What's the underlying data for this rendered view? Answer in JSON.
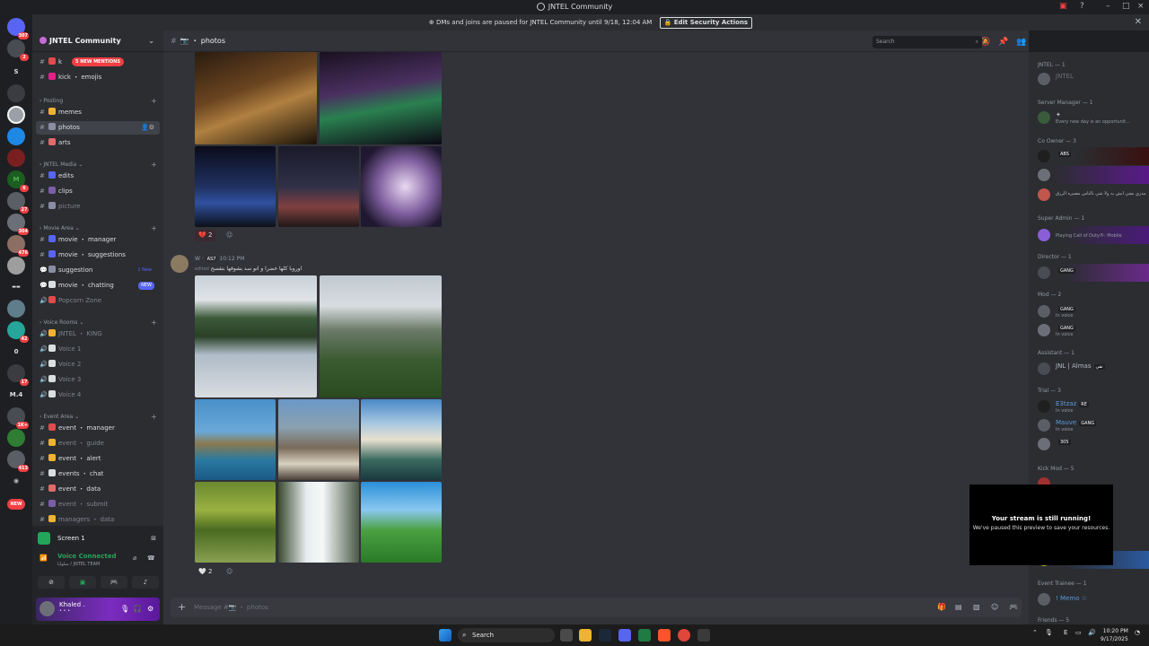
{
  "window": {
    "title": "JNTEL Community",
    "controls": [
      "–",
      "□",
      "×"
    ]
  },
  "banner": {
    "text": "DMs and joins are paused for JNTEL Community until 9/18, 12:04 AM",
    "button": "Edit Security Actions"
  },
  "server_rail": [
    {
      "label": "",
      "badge": "307"
    },
    {
      "label": "",
      "badge": "2"
    },
    {
      "label": "S",
      "badge": ""
    },
    {
      "label": "",
      "badge": ""
    },
    {
      "label": "",
      "badge": ""
    },
    {
      "label": "",
      "badge": ""
    },
    {
      "label": "",
      "badge": ""
    },
    {
      "label": "M",
      "badge": "6"
    },
    {
      "label": "",
      "badge": "27"
    },
    {
      "label": "",
      "badge": "304"
    },
    {
      "label": "",
      "badge": "476"
    },
    {
      "label": "",
      "badge": ""
    },
    {
      "label": "",
      "badge": ""
    },
    {
      "label": "",
      "badge": ""
    },
    {
      "label": "",
      "badge": "42"
    },
    {
      "label": "0",
      "badge": ""
    },
    {
      "label": "",
      "badge": "17"
    },
    {
      "label": "M.4",
      "badge": ""
    },
    {
      "label": "",
      "badge": "1K+"
    },
    {
      "label": "",
      "badge": ""
    },
    {
      "label": "",
      "badge": "413"
    },
    {
      "label": "",
      "badge": ""
    },
    {
      "label": "NEW",
      "badge": ""
    }
  ],
  "sidebar": {
    "server_name": "JNTEL Community",
    "mentions_pill": "5 NEW MENTIONS",
    "categories": [
      {
        "name": "Posting"
      },
      {
        "name": "JNTEL Media"
      },
      {
        "name": "Movie Area"
      },
      {
        "name": "Voice Rooms"
      },
      {
        "name": "Event Area"
      }
    ],
    "channels": [
      {
        "name": "k",
        "icon": "#",
        "emoji_color": "#e04b4b",
        "muted": false,
        "tag": ""
      },
      {
        "name": "kick ・ emojis",
        "icon": "#",
        "emoji_color": "#e91e8c",
        "muted": false,
        "tag": ""
      },
      {
        "name": "memes",
        "icon": "#",
        "emoji_color": "#f0b232",
        "muted": false,
        "tag": ""
      },
      {
        "name": "photos",
        "icon": "#",
        "emoji_color": "#8a8ea3",
        "muted": false,
        "tag": ""
      },
      {
        "name": "arts",
        "icon": "#",
        "emoji_color": "#e06b6b",
        "muted": false,
        "tag": ""
      },
      {
        "name": "edits",
        "icon": "#",
        "emoji_color": "#5865f2",
        "muted": false,
        "tag": ""
      },
      {
        "name": "clips",
        "icon": "#",
        "emoji_color": "#7b5ea7",
        "muted": false,
        "tag": ""
      },
      {
        "name": "picture",
        "icon": "#",
        "emoji_color": "#8a8ea3",
        "muted": true,
        "tag": ""
      },
      {
        "name": "movie ・ manager",
        "icon": "#",
        "emoji_color": "#5865f2",
        "muted": false,
        "tag": ""
      },
      {
        "name": "movie ・ suggestions",
        "icon": "#",
        "emoji_color": "#5865f2",
        "muted": false,
        "tag": ""
      },
      {
        "name": "suggestion",
        "icon": "💬",
        "emoji_color": "#8a8ea3",
        "muted": false,
        "tag": "1 New"
      },
      {
        "name": "movie ・ chatting",
        "icon": "#",
        "emoji_color": "#dbdee1",
        "muted": false,
        "tag": "NEW"
      },
      {
        "name": "Popcorn Zone",
        "icon": "🔊",
        "emoji_color": "#e04b4b",
        "muted": true,
        "tag": ""
      },
      {
        "name": "JNTEL ・ KING",
        "icon": "🔊",
        "emoji_color": "#f0b232",
        "muted": true,
        "tag": ""
      },
      {
        "name": "Voice 1",
        "icon": "🔊",
        "emoji_color": "#dbdee1",
        "muted": true,
        "tag": ""
      },
      {
        "name": "Voice 2",
        "icon": "🔊",
        "emoji_color": "#dbdee1",
        "muted": true,
        "tag": ""
      },
      {
        "name": "Voice 3",
        "icon": "🔊",
        "emoji_color": "#dbdee1",
        "muted": true,
        "tag": ""
      },
      {
        "name": "Voice 4",
        "icon": "🔊",
        "emoji_color": "#dbdee1",
        "muted": true,
        "tag": ""
      },
      {
        "name": "event ・ manager",
        "icon": "#",
        "emoji_color": "#e04b4b",
        "muted": false,
        "tag": ""
      },
      {
        "name": "event ・ guide",
        "icon": "#",
        "emoji_color": "#f0b232",
        "muted": true,
        "tag": ""
      },
      {
        "name": "event ・ alert",
        "icon": "#",
        "emoji_color": "#f0b232",
        "muted": false,
        "tag": ""
      },
      {
        "name": "events ・ chat",
        "icon": "#",
        "emoji_color": "#dbdee1",
        "muted": false,
        "tag": ""
      },
      {
        "name": "event ・ data",
        "icon": "#",
        "emoji_color": "#e06b6b",
        "muted": false,
        "tag": ""
      },
      {
        "name": "event ・ submit",
        "icon": "#",
        "emoji_color": "#7b5ea7",
        "muted": true,
        "tag": ""
      },
      {
        "name": "managers ・ data",
        "icon": "#",
        "emoji_color": "#f0b232",
        "muted": true,
        "tag": ""
      }
    ]
  },
  "voice_panel": {
    "screen_label": "Screen 1",
    "status": "Voice Connected",
    "sub": "سلوايا / JNTEL TEAM",
    "user_name": "Khaled .",
    "user_sub": "• • •"
  },
  "chat": {
    "channel": "photos",
    "search_placeholder": "Search",
    "reactions": [
      {
        "emoji": "💔",
        "count": "2"
      },
      {
        "emoji": "🤍",
        "count": "2"
      }
    ],
    "message": {
      "author": "W",
      "role": "AS7",
      "time": "10:12 PM",
      "edited_label": "edited",
      "text": "اوروبا كلها خضرا و انو سد بشوفها بتفسح"
    },
    "composer_placeholder": "Message #📷 ・ photos"
  },
  "members": {
    "roles": [
      {
        "name": "JNTEL — 1"
      },
      {
        "name": "Server Manager — 1"
      },
      {
        "name": "Co Owner — 3"
      },
      {
        "name": "Super Admin — 1"
      },
      {
        "name": "Director — 1"
      },
      {
        "name": "Mod — 2"
      },
      {
        "name": "Assistant — 1"
      },
      {
        "name": "Trial — 3"
      },
      {
        "name": "Kick Mod — 5"
      },
      {
        "name": "Event Trainee — 1"
      },
      {
        "name": "Friends — 5"
      }
    ],
    "items": [
      {
        "name": "JNTEL",
        "tag": "",
        "status": "",
        "color": "#5c5e66"
      },
      {
        "name": "",
        "tag": "",
        "status": "Every new day is an opportunit...",
        "color": "#3a5c3a"
      },
      {
        "name": "",
        "tag": "ABS",
        "status": "",
        "color": "#1f1f1f"
      },
      {
        "name": "",
        "tag": "",
        "status": "",
        "color": "#6d6f78"
      },
      {
        "name": "",
        "tag": "",
        "status": "مدري بشي ايش به ولا شي بالناس مصيره الرزق",
        "color": "#c0564c"
      },
      {
        "name": "",
        "tag": "",
        "status": "Playing Call of Duty®: Mobile",
        "color": "#8a5fd6"
      },
      {
        "name": "",
        "tag": "GANG",
        "status": "",
        "color": "#4a4c53"
      },
      {
        "name": "",
        "tag": "GANG",
        "status": "In voice",
        "color": "#5c5e66"
      },
      {
        "name": "",
        "tag": "GANG",
        "status": "In voice",
        "color": "#6d6f78"
      },
      {
        "name": "JNL | Almas",
        "tag": "نقي",
        "status": "",
        "color": "#4a4c53"
      },
      {
        "name": "E3tzaz",
        "tag": "RE",
        "status": "In voice",
        "color": "#1f1f1f"
      },
      {
        "name": "Mauve",
        "tag": "GANG",
        "status": "In voice",
        "color": "#5c5e66"
      },
      {
        "name": "",
        "tag": "305",
        "status": "",
        "color": "#6d6f78"
      },
      {
        "name": "! Memo ☆",
        "tag": "",
        "status": "",
        "color": "#5c5e66"
      }
    ]
  },
  "overlay": {
    "title": "Your stream is still running!",
    "body": "We've paused this preview to save your resources."
  },
  "taskbar": {
    "search": "Search",
    "clock_time": "10:20 PM",
    "clock_date": "9/17/2025",
    "lang": "E"
  }
}
